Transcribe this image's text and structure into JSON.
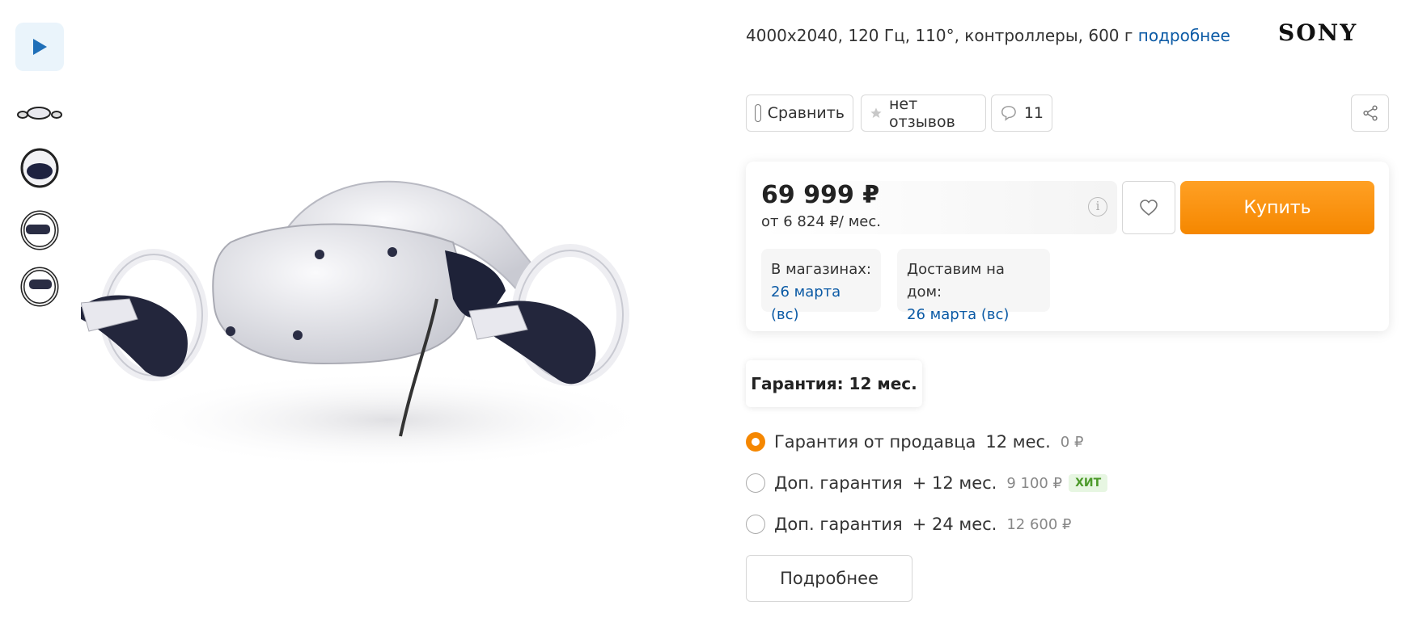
{
  "gallery": {
    "thumbnails": [
      "video-play",
      "headset-side",
      "headset-front",
      "controller-right",
      "controller-left"
    ]
  },
  "product": {
    "specs": "4000x2040, 120 Гц, 110°, контроллеры, 600 г",
    "specs_link": "подробнее",
    "brand": "SONY"
  },
  "actions": {
    "compare_label": "Сравнить",
    "reviews_label": "нет отзывов",
    "questions_count": "11"
  },
  "purchase": {
    "price": "69 999 ₽",
    "monthly": "от 6 824 ₽/ мес.",
    "buy_label": "Купить",
    "stores_label": "В магазинах:",
    "stores_date": "26 марта (вс)",
    "delivery_label": "Доставим на дом:",
    "delivery_date": "26 марта (вс)"
  },
  "warranty": {
    "title": "Гарантия: 12 мес.",
    "options": [
      {
        "name": "Гарантия от продавца",
        "term": "12 мес.",
        "cost": "0 ₽",
        "badge": "",
        "selected": true
      },
      {
        "name": "Доп. гарантия",
        "term": "+ 12 мес.",
        "cost": "9 100 ₽",
        "badge": "ХИТ",
        "selected": false
      },
      {
        "name": "Доп. гарантия",
        "term": "+ 24 мес.",
        "cost": "12 600 ₽",
        "badge": "",
        "selected": false
      }
    ],
    "more_label": "Подробнее"
  },
  "colors": {
    "accent": "#f58700",
    "link": "#0b5aa5",
    "hit_bg": "#e7f6e2",
    "hit_text": "#4c9a2a"
  }
}
